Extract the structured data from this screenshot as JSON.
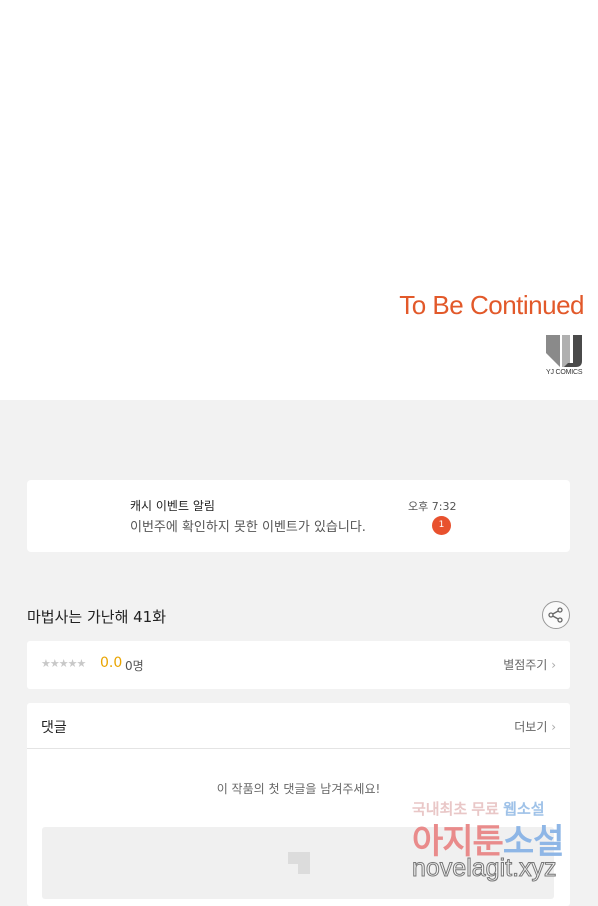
{
  "comic": {
    "end_text": "To Be Continued",
    "logo_text": "YJ COMICS"
  },
  "notification": {
    "title": "캐시 이벤트 알림",
    "message": "이번주에 확인하지 못한 이벤트가 있습니다.",
    "time": "오후 7:32",
    "badge_count": "1",
    "badge_color": "#e8512e"
  },
  "episode": {
    "title": "마법사는 가난해 41화",
    "share_icon": "share-icon"
  },
  "rating": {
    "stars": "★★★★★",
    "score": "0.0",
    "count": "0명",
    "rate_label": "별점주기",
    "score_color": "#e9a400"
  },
  "comments": {
    "title": "댓글",
    "more_label": "더보기",
    "empty_message": "이 작품의 첫 댓글을 남겨주세요!"
  },
  "watermark": {
    "line1_a": "국내최초 무료",
    "line1_b": "웹소설",
    "line2_a": "아지툰",
    "line2_b": "소설",
    "line3": "novelagit.xyz"
  }
}
